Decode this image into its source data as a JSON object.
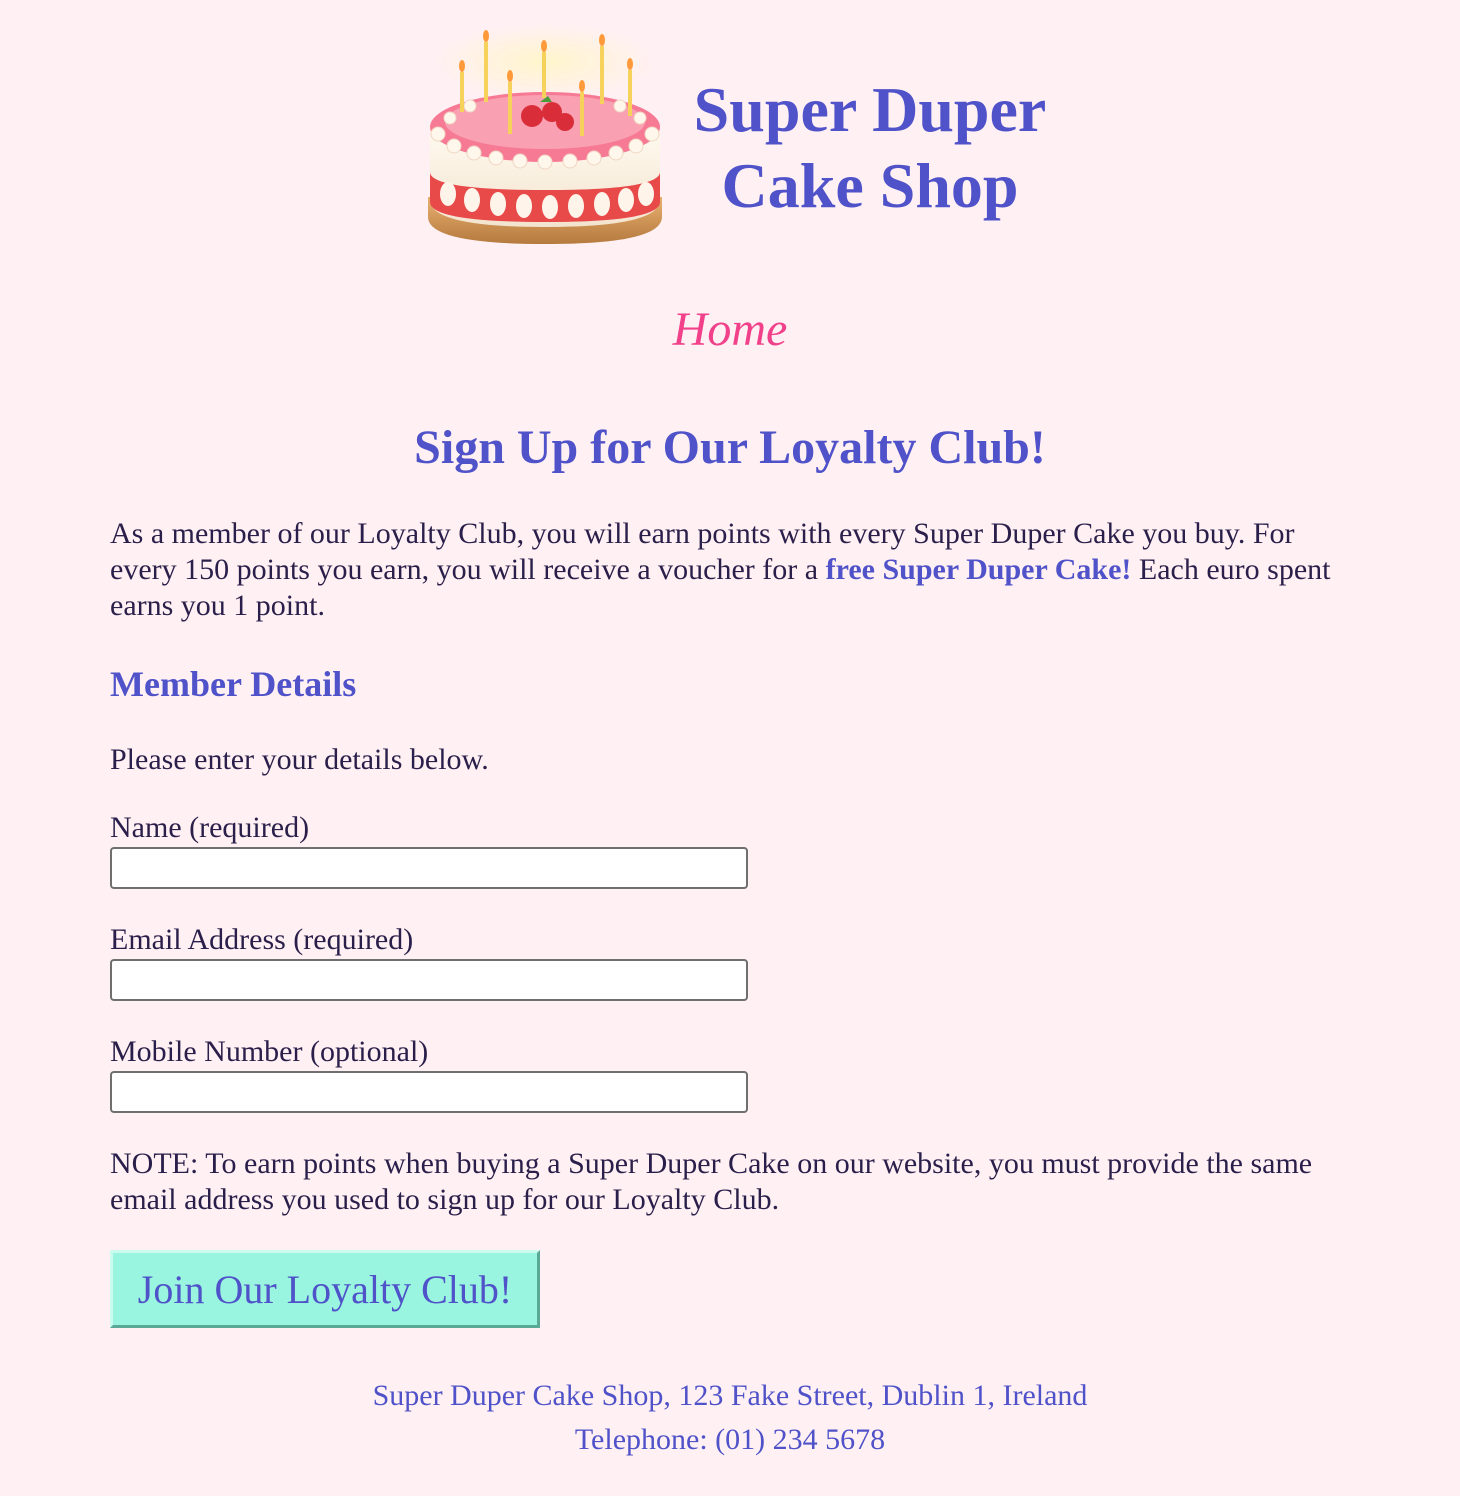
{
  "header": {
    "brand_line1": "Super Duper",
    "brand_line2": "Cake Shop"
  },
  "nav": {
    "home_label": "Home"
  },
  "page": {
    "title": "Sign Up for Our Loyalty Club!",
    "intro_text": "As a member of our Loyalty Club, you will earn points with every Super Duper Cake you buy. For every 150 points you earn, you will receive a voucher for a ",
    "intro_highlight": "free Super Duper Cake!",
    "intro_text_end": " Each euro spent earns you 1 point."
  },
  "form": {
    "section_heading": "Member Details",
    "instruction": "Please enter your details below.",
    "name_label": "Name (required)",
    "name_value": "",
    "email_label": "Email Address (required)",
    "email_value": "",
    "mobile_label": "Mobile Number (optional)",
    "mobile_value": "",
    "note": "NOTE: To earn points when buying a Super Duper Cake on our website, you must provide the same email address you used to sign up for our Loyalty Club.",
    "submit_label": "Join Our Loyalty Club!"
  },
  "footer": {
    "address": "Super Duper Cake Shop, 123 Fake Street, Dublin 1, Ireland",
    "telephone": "Telephone: (01) 234 5678"
  },
  "colors": {
    "background": "#fff0f3",
    "brand": "#4f52c8",
    "nav_link": "#f0418a",
    "button": "#99f5e0",
    "text": "#2a1f4a"
  },
  "icons": {
    "logo": "cake-icon"
  }
}
